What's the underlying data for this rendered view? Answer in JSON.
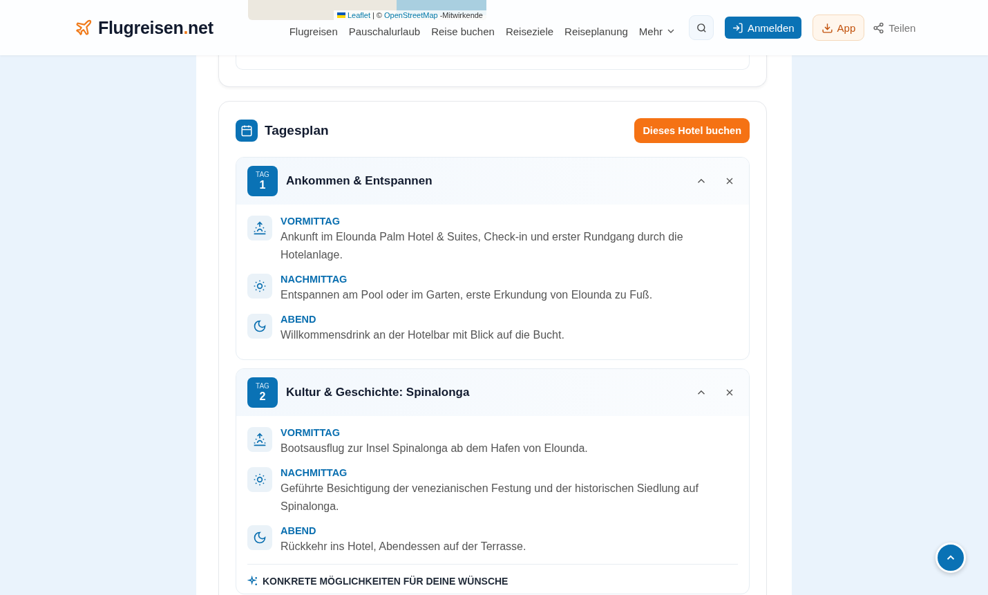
{
  "map": {
    "attribution": [
      {
        "kind": "link",
        "text": "Leaflet"
      },
      {
        "kind": "text",
        "text": "| ©"
      },
      {
        "kind": "link",
        "text": "OpenStreetMap"
      },
      {
        "kind": "text",
        "text": "-Mitwirkende"
      }
    ]
  },
  "header": {
    "logo": {
      "name": "Flugreisen",
      "dot": ".",
      "tld": "net"
    },
    "nav": [
      "Flugreisen",
      "Pauschalurlaub",
      "Reise buchen",
      "Reiseziele",
      "Reiseplanung"
    ],
    "more": "Mehr",
    "login": "Anmelden",
    "app": "App",
    "share": "Teilen"
  },
  "tagesplan": {
    "title": "Tagesplan",
    "book_button": "Dieses Hotel buchen",
    "days": [
      {
        "tag_label": "TAG",
        "number": "1",
        "title": "Ankommen & Entspannen",
        "expanded": true,
        "slots": [
          {
            "kind": "morning",
            "label": "VORMITTAG",
            "text": "Ankunft im Elounda Palm Hotel & Suites, Check-in und erster Rundgang durch die Hotelanlage."
          },
          {
            "kind": "afternoon",
            "label": "NACHMITTAG",
            "text": "Entspannen am Pool oder im Garten, erste Erkundung von Elounda zu Fuß."
          },
          {
            "kind": "evening",
            "label": "ABEND",
            "text": "Willkommensdrink an der Hotelbar mit Blick auf die Bucht."
          }
        ]
      },
      {
        "tag_label": "TAG",
        "number": "2",
        "title": "Kultur & Geschichte: Spinalonga",
        "expanded": true,
        "slots": [
          {
            "kind": "morning",
            "label": "VORMITTAG",
            "text": "Bootsausflug zur Insel Spinalonga ab dem Hafen von Elounda."
          },
          {
            "kind": "afternoon",
            "label": "NACHMITTAG",
            "text": "Geführte Besichtigung der venezianischen Festung und der historischen Siedlung auf Spinalonga."
          },
          {
            "kind": "evening",
            "label": "ABEND",
            "text": "Rückkehr ins Hotel, Abendessen auf der Terrasse."
          }
        ],
        "wishes_heading": "KONKRETE MÖGLICHKEITEN FÜR DEINE WÜNSCHE"
      }
    ]
  }
}
